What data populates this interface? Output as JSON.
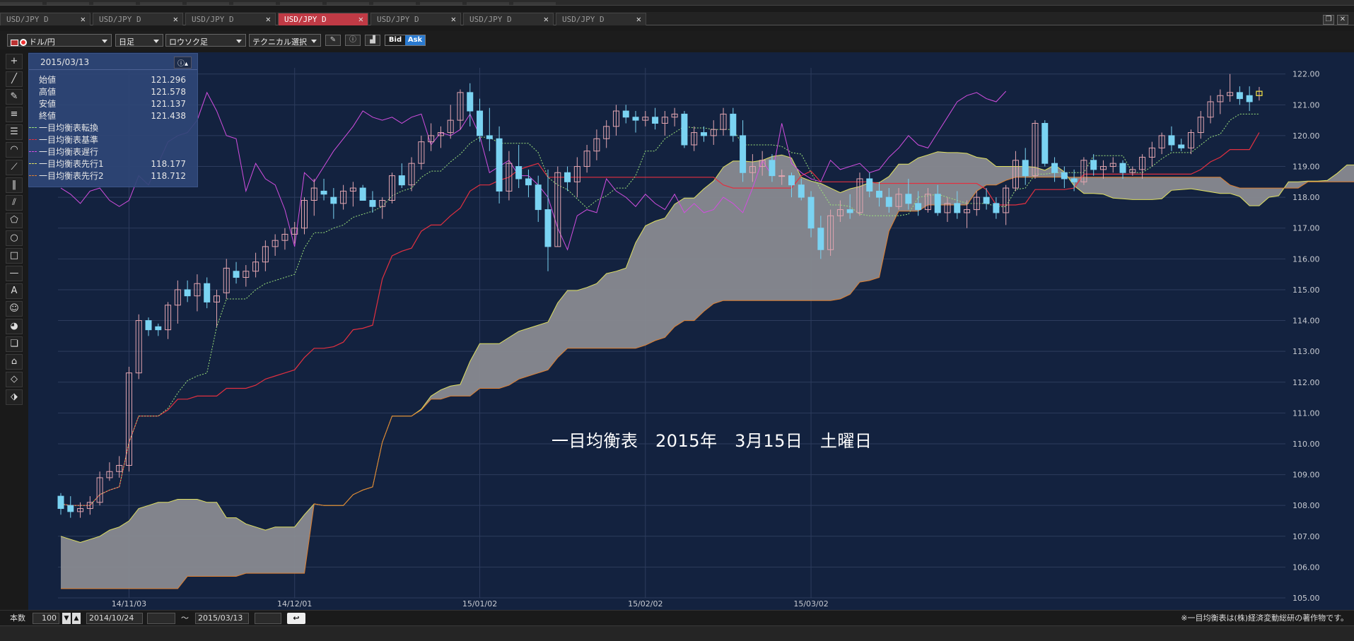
{
  "tabs": [
    {
      "label": "USD/JPY D",
      "active": false
    },
    {
      "label": "USD/JPY D",
      "active": false
    },
    {
      "label": "USD/JPY D",
      "active": false
    },
    {
      "label": "USD/JPY D",
      "active": true
    },
    {
      "label": "USD/JPY D",
      "active": false
    },
    {
      "label": "USD/JPY D",
      "active": false
    },
    {
      "label": "USD/JPY D",
      "active": false
    }
  ],
  "toolbar": {
    "symbol": "ドル/円",
    "timeframe": "日足",
    "chart_type": "ロウソク足",
    "technical": "テクニカル選択",
    "bid_label": "Bid",
    "ask_label": "Ask"
  },
  "info_panel": {
    "date": "2015/03/13",
    "rows": [
      {
        "label": "始値",
        "value": "121.296"
      },
      {
        "label": "高値",
        "value": "121.578"
      },
      {
        "label": "安値",
        "value": "121.137"
      },
      {
        "label": "終値",
        "value": "121.438"
      }
    ],
    "legend": [
      {
        "label": "一目均衡表転換",
        "value": "",
        "color": "#9be07a"
      },
      {
        "label": "一目均衡表基準",
        "value": "",
        "color": "#e23040"
      },
      {
        "label": "一目均衡表遅行",
        "value": "",
        "color": "#d24ee0"
      },
      {
        "label": "一目均衡表先行1",
        "value": "118.177",
        "color": "#e0e060"
      },
      {
        "label": "一目均衡表先行2",
        "value": "118.712",
        "color": "#e08030"
      }
    ]
  },
  "watermark": "一目均衡表　2015年　3月15日　土曜日",
  "bottom": {
    "count_label": "本数",
    "count_value": "100",
    "start_date": "2014/10/24",
    "tilde": "〜",
    "end_date": "2015/03/13",
    "copyright": "※一目均衡表は(株)経済変動総研の著作物です。"
  },
  "colors": {
    "background": "#13223f",
    "up_candle": "#e2a5b0",
    "down_candle": "#7ad3f2",
    "tenkan": "#9be07a",
    "kijun": "#e23040",
    "chikou": "#d24ee0",
    "span_a": "#e0e060",
    "span_b": "#e08030",
    "cloud": "#888a90"
  },
  "chart_data": {
    "type": "candlestick",
    "ylim": [
      105.0,
      122.2
    ],
    "y_ticks": [
      "122.00",
      "121.00",
      "120.00",
      "119.00",
      "118.00",
      "117.00",
      "116.00",
      "115.00",
      "114.00",
      "113.00",
      "112.00",
      "111.00",
      "110.00",
      "109.00",
      "108.00",
      "107.00",
      "106.00",
      "105.00"
    ],
    "x_ticks": [
      "14/11/03",
      "14/12/01",
      "15/01/02",
      "15/02/02",
      "15/03/02"
    ],
    "candles": [
      [
        108.3,
        108.4,
        107.7,
        107.9
      ],
      [
        108.0,
        108.3,
        107.6,
        107.8
      ],
      [
        107.8,
        108.1,
        107.6,
        107.9
      ],
      [
        107.9,
        108.3,
        107.7,
        108.1
      ],
      [
        108.1,
        109.1,
        108.0,
        108.9
      ],
      [
        108.9,
        109.4,
        108.8,
        109.1
      ],
      [
        109.1,
        109.6,
        108.9,
        109.3
      ],
      [
        109.3,
        112.5,
        109.1,
        112.3
      ],
      [
        112.3,
        114.2,
        112.1,
        114.0
      ],
      [
        114.0,
        114.1,
        113.5,
        113.7
      ],
      [
        113.8,
        113.9,
        113.5,
        113.7
      ],
      [
        113.7,
        114.6,
        113.4,
        114.5
      ],
      [
        114.5,
        115.3,
        113.9,
        115.0
      ],
      [
        115.0,
        115.3,
        114.6,
        114.8
      ],
      [
        114.8,
        115.5,
        114.3,
        115.2
      ],
      [
        115.2,
        115.4,
        114.4,
        114.6
      ],
      [
        114.6,
        115.0,
        113.8,
        114.8
      ],
      [
        114.9,
        116.0,
        114.7,
        115.7
      ],
      [
        115.6,
        115.9,
        115.2,
        115.4
      ],
      [
        115.4,
        115.8,
        115.1,
        115.6
      ],
      [
        115.6,
        116.2,
        115.4,
        115.9
      ],
      [
        115.9,
        116.6,
        115.6,
        116.4
      ],
      [
        116.4,
        116.8,
        116.1,
        116.6
      ],
      [
        116.6,
        117.0,
        116.3,
        116.8
      ],
      [
        116.8,
        117.2,
        116.5,
        117.0
      ],
      [
        117.0,
        118.0,
        116.8,
        117.9
      ],
      [
        117.9,
        118.6,
        117.4,
        118.3
      ],
      [
        118.2,
        118.6,
        117.9,
        118.1
      ],
      [
        118.0,
        118.3,
        117.3,
        117.8
      ],
      [
        117.8,
        118.4,
        117.6,
        118.2
      ],
      [
        118.2,
        118.5,
        117.7,
        118.3
      ],
      [
        118.3,
        118.4,
        117.9,
        117.9
      ],
      [
        117.9,
        118.2,
        117.5,
        117.7
      ],
      [
        117.7,
        118.0,
        117.3,
        117.9
      ],
      [
        117.9,
        118.8,
        117.8,
        118.7
      ],
      [
        118.7,
        119.1,
        118.3,
        118.4
      ],
      [
        118.4,
        119.3,
        118.2,
        119.1
      ],
      [
        119.1,
        120.0,
        118.9,
        119.8
      ],
      [
        119.8,
        120.4,
        119.5,
        120.0
      ],
      [
        120.0,
        120.3,
        119.6,
        120.1
      ],
      [
        120.1,
        121.0,
        119.9,
        120.5
      ],
      [
        120.5,
        121.5,
        120.2,
        121.4
      ],
      [
        121.4,
        121.7,
        120.3,
        120.8
      ],
      [
        120.8,
        121.2,
        119.8,
        120.0
      ],
      [
        120.0,
        120.9,
        119.5,
        119.9
      ],
      [
        119.9,
        120.3,
        117.8,
        118.2
      ],
      [
        118.2,
        119.5,
        117.9,
        119.1
      ],
      [
        119.0,
        119.7,
        118.3,
        118.6
      ],
      [
        118.6,
        118.9,
        118.0,
        118.4
      ],
      [
        118.4,
        118.7,
        117.2,
        117.6
      ],
      [
        117.6,
        118.9,
        115.6,
        116.4
      ],
      [
        116.4,
        119.0,
        116.4,
        118.8
      ],
      [
        118.8,
        119.0,
        118.2,
        118.5
      ],
      [
        118.5,
        119.3,
        118.0,
        119.0
      ],
      [
        119.0,
        119.7,
        118.8,
        119.5
      ],
      [
        119.5,
        120.2,
        119.2,
        119.9
      ],
      [
        119.9,
        120.5,
        119.6,
        120.3
      ],
      [
        120.3,
        121.0,
        120.0,
        120.8
      ],
      [
        120.8,
        121.0,
        120.4,
        120.6
      ],
      [
        120.6,
        120.8,
        120.1,
        120.5
      ],
      [
        120.5,
        120.8,
        120.3,
        120.6
      ],
      [
        120.6,
        120.9,
        120.2,
        120.4
      ],
      [
        120.4,
        120.8,
        120.0,
        120.6
      ],
      [
        120.6,
        120.9,
        120.3,
        120.7
      ],
      [
        120.7,
        120.8,
        119.6,
        119.7
      ],
      [
        119.7,
        120.3,
        119.5,
        120.1
      ],
      [
        120.1,
        120.3,
        119.8,
        120.0
      ],
      [
        120.0,
        120.5,
        119.7,
        120.2
      ],
      [
        120.2,
        120.9,
        120.0,
        120.7
      ],
      [
        120.7,
        120.9,
        119.8,
        120.0
      ],
      [
        120.0,
        120.5,
        118.5,
        118.8
      ],
      [
        118.8,
        119.4,
        118.5,
        119.0
      ],
      [
        119.0,
        119.5,
        118.7,
        119.2
      ],
      [
        119.2,
        119.4,
        118.5,
        118.7
      ],
      [
        118.7,
        118.9,
        118.4,
        118.7
      ],
      [
        118.7,
        118.8,
        118.0,
        118.4
      ],
      [
        118.4,
        118.6,
        117.9,
        118.0
      ],
      [
        118.0,
        118.2,
        116.7,
        117.0
      ],
      [
        117.0,
        117.4,
        116.0,
        116.3
      ],
      [
        116.3,
        117.6,
        116.1,
        117.4
      ],
      [
        117.4,
        117.9,
        117.2,
        117.6
      ],
      [
        117.6,
        118.1,
        117.3,
        117.5
      ],
      [
        117.5,
        118.8,
        117.4,
        118.6
      ],
      [
        118.6,
        118.8,
        118.0,
        118.2
      ],
      [
        118.2,
        118.5,
        117.7,
        118.0
      ],
      [
        118.0,
        118.3,
        117.5,
        117.7
      ],
      [
        117.7,
        118.3,
        117.6,
        118.1
      ],
      [
        118.1,
        118.6,
        117.6,
        117.8
      ],
      [
        117.8,
        118.2,
        117.4,
        117.6
      ],
      [
        117.6,
        118.3,
        117.5,
        118.1
      ],
      [
        118.1,
        118.4,
        117.4,
        117.5
      ],
      [
        117.5,
        118.0,
        117.2,
        117.8
      ],
      [
        117.8,
        118.2,
        117.3,
        117.5
      ],
      [
        117.5,
        117.9,
        117.0,
        117.6
      ],
      [
        117.6,
        118.2,
        117.4,
        118.0
      ]
    ],
    "candles2": [
      [
        118.0,
        118.3,
        117.6,
        117.8
      ],
      [
        117.8,
        118.0,
        117.3,
        117.5
      ],
      [
        117.5,
        118.4,
        117.1,
        118.3
      ],
      [
        118.3,
        119.5,
        118.2,
        119.2
      ],
      [
        119.2,
        119.6,
        118.4,
        118.7
      ],
      [
        118.7,
        120.5,
        118.6,
        120.4
      ],
      [
        120.4,
        120.5,
        119.0,
        119.1
      ],
      [
        119.1,
        119.3,
        118.5,
        118.8
      ],
      [
        118.8,
        119.0,
        118.3,
        118.6
      ],
      [
        118.6,
        118.9,
        118.2,
        118.5
      ],
      [
        118.5,
        119.3,
        118.4,
        119.2
      ],
      [
        119.2,
        119.4,
        118.7,
        118.9
      ],
      [
        118.9,
        119.2,
        118.6,
        119.0
      ],
      [
        119.0,
        119.3,
        118.8,
        119.1
      ],
      [
        119.1,
        119.2,
        118.6,
        118.8
      ],
      [
        118.8,
        119.0,
        118.7,
        118.9
      ],
      [
        118.9,
        119.4,
        118.6,
        119.3
      ],
      [
        119.3,
        119.8,
        119.0,
        119.6
      ],
      [
        119.6,
        120.1,
        119.4,
        120.0
      ],
      [
        120.0,
        120.3,
        119.5,
        119.7
      ],
      [
        119.7,
        119.9,
        119.5,
        119.6
      ],
      [
        119.6,
        120.2,
        119.4,
        120.1
      ],
      [
        120.1,
        120.8,
        119.9,
        120.6
      ],
      [
        120.6,
        121.3,
        120.4,
        121.1
      ],
      [
        121.1,
        121.5,
        120.7,
        121.3
      ],
      [
        121.3,
        122.0,
        121.1,
        121.4
      ],
      [
        121.4,
        121.6,
        121.0,
        121.2
      ],
      [
        121.3,
        121.6,
        120.8,
        121.1
      ],
      [
        121.3,
        121.58,
        121.14,
        121.44
      ]
    ],
    "chikou": [
      119.2,
      118.1,
      117.0,
      116.5,
      117.8,
      118.8,
      119.6,
      121.4,
      120.6,
      119.9,
      119.8,
      120.3,
      119.7,
      120.9,
      121.0,
      120.5,
      120.4,
      119.5,
      119.8,
      120.6,
      119.3,
      118.5,
      117.5,
      116.3,
      118.4,
      119.2,
      118.7,
      118.3,
      118.0,
      118.6,
      118.8,
      118.2,
      117.8,
      118.6,
      119.0,
      118.5,
      118.9,
      119.4,
      120.0,
      120.5,
      120.2,
      120.4,
      119.9,
      119.6,
      120.0,
      119.8,
      119.5,
      119.3,
      119.2,
      119.7,
      120.5,
      121.2,
      121.2,
      121.4
    ],
    "tenkan_from": 0,
    "tenkan": [
      107.6,
      107.8,
      108.2,
      108.7,
      109.4,
      110.0,
      110.5,
      110.8,
      111.1,
      111.3,
      111.5,
      111.8,
      112.3,
      112.8,
      113.2,
      113.5,
      113.8,
      114.1,
      114.4,
      114.9,
      115.2,
      115.4,
      115.7,
      116.0,
      116.3,
      116.6,
      116.9,
      117.2,
      117.4,
      117.5,
      117.6,
      117.8,
      118.0,
      118.2,
      118.4,
      118.5,
      118.6,
      118.7,
      118.8,
      119.0,
      119.4,
      119.7,
      119.9,
      119.8,
      119.6,
      119.4,
      119.0,
      118.8,
      118.6,
      118.6,
      118.7,
      118.8,
      119.2,
      119.6,
      119.9,
      120.1,
      120.2,
      120.0,
      119.8,
      119.6,
      119.5,
      119.4,
      119.3,
      119.2,
      119.0,
      118.8,
      118.6,
      118.4,
      118.4,
      118.2,
      118.1,
      118.1,
      118.1,
      118.0,
      117.9,
      117.9,
      118.1,
      118.3,
      118.4,
      118.4,
      118.3,
      118.1,
      118.0,
      117.9,
      117.9,
      117.8,
      117.8,
      117.9,
      118.2,
      118.6,
      118.9,
      118.7,
      118.6,
      118.6,
      118.7,
      118.6,
      118.9,
      119.3,
      119.4,
      119.4,
      119.4,
      119.2,
      119.2,
      119.5,
      119.6,
      119.8,
      120.0,
      120.2,
      120.6,
      120.9,
      121.0,
      121.0
    ]
  }
}
